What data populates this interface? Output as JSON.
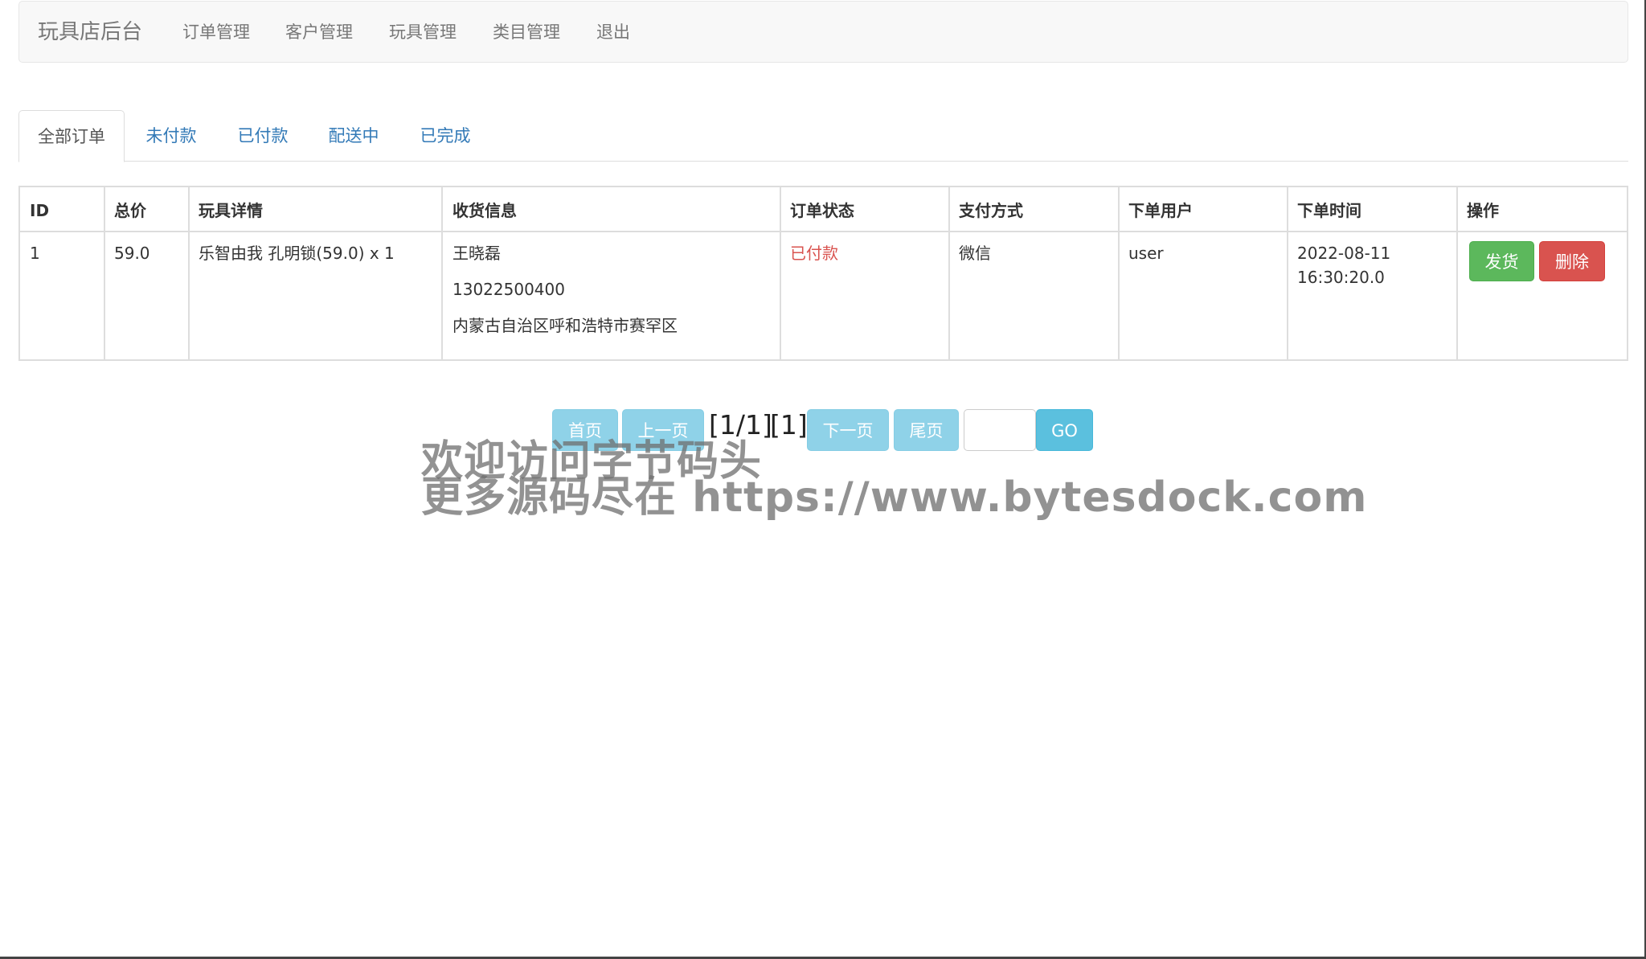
{
  "navbar": {
    "brand": "玩具店后台",
    "links": [
      "订单管理",
      "客户管理",
      "玩具管理",
      "类目管理",
      "退出"
    ]
  },
  "tabs": [
    "全部订单",
    "未付款",
    "已付款",
    "配送中",
    "已完成"
  ],
  "table": {
    "headers": [
      "ID",
      "总价",
      "玩具详情",
      "收货信息",
      "订单状态",
      "支付方式",
      "下单用户",
      "下单时间",
      "操作"
    ],
    "rows": [
      {
        "id": "1",
        "total": "59.0",
        "detail": "乐智由我 孔明锁(59.0) x 1",
        "receiver_name": "王晓磊",
        "receiver_phone": "13022500400",
        "receiver_address": "内蒙古自治区呼和浩特市赛罕区",
        "status": "已付款",
        "payment": "微信",
        "user": "user",
        "date": "2022-08-11",
        "time": "16:30:20.0",
        "ship_label": "发货",
        "delete_label": "删除"
      }
    ]
  },
  "pagination": {
    "first": "首页",
    "prev": "上一页",
    "page_info": "[1/1]",
    "page_link": "[1]",
    "next": "下一页",
    "last": "尾页",
    "go": "GO"
  },
  "watermark": {
    "line1": "欢迎访问字节码头",
    "line2": "更多源码尽在  https://www.bytesdock.com"
  }
}
